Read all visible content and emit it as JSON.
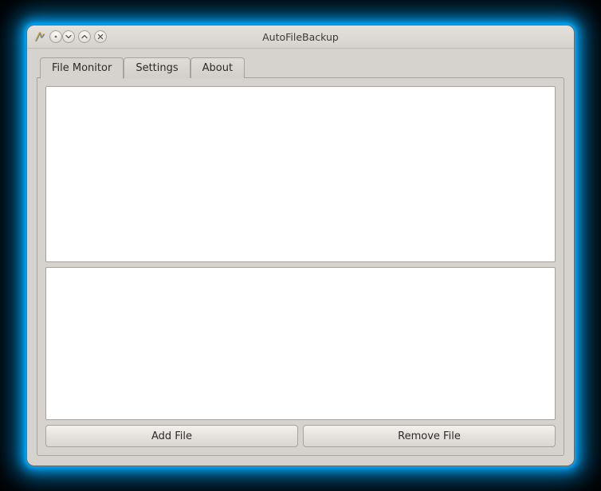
{
  "window": {
    "title": "AutoFileBackup"
  },
  "tabs": [
    {
      "label": "File Monitor",
      "active": true
    },
    {
      "label": "Settings",
      "active": false
    },
    {
      "label": "About",
      "active": false
    }
  ],
  "buttons": {
    "add_file": "Add File",
    "remove_file": "Remove File"
  }
}
